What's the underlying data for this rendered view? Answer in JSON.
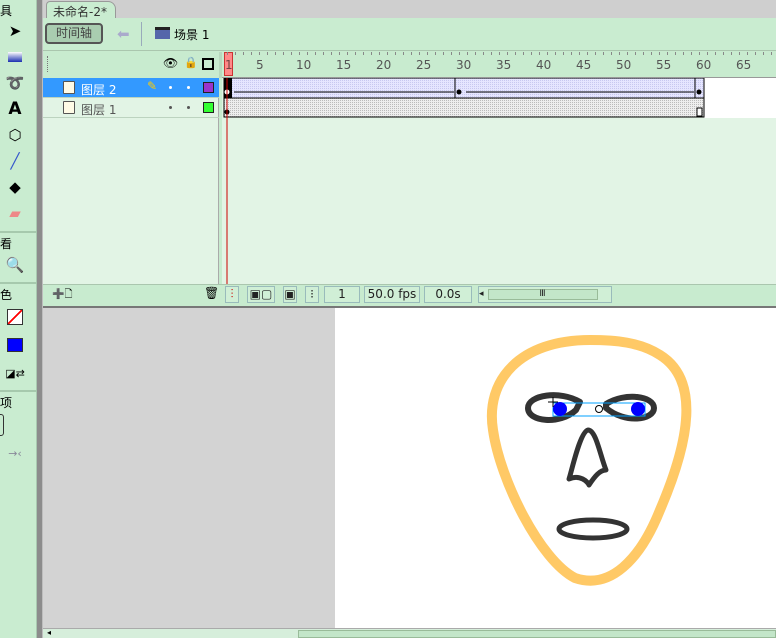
{
  "tools": {
    "section_tools": "具",
    "section_view": "看",
    "section_colors": "色",
    "section_options": "项"
  },
  "document_tab": "未命名-2*",
  "toolbar": {
    "timeline_button": "时间轴",
    "scene_label": "场景 1"
  },
  "timeline": {
    "ruler_labels": [
      "1",
      "5",
      "10",
      "15",
      "20",
      "25",
      "30",
      "35",
      "40",
      "45",
      "50",
      "55",
      "60",
      "65"
    ],
    "layers": [
      {
        "name": "图层 2",
        "selected": true,
        "color": "#9933cc"
      },
      {
        "name": "图层 1",
        "selected": false,
        "color": "#33ff33"
      }
    ],
    "current_frame": "1",
    "fps": "50.0 fps",
    "time": "0.0s"
  },
  "colors": {
    "stroke": "#ff0000",
    "fill": "#0000ff",
    "face_outline": "#ffc966",
    "features": "#333333"
  }
}
